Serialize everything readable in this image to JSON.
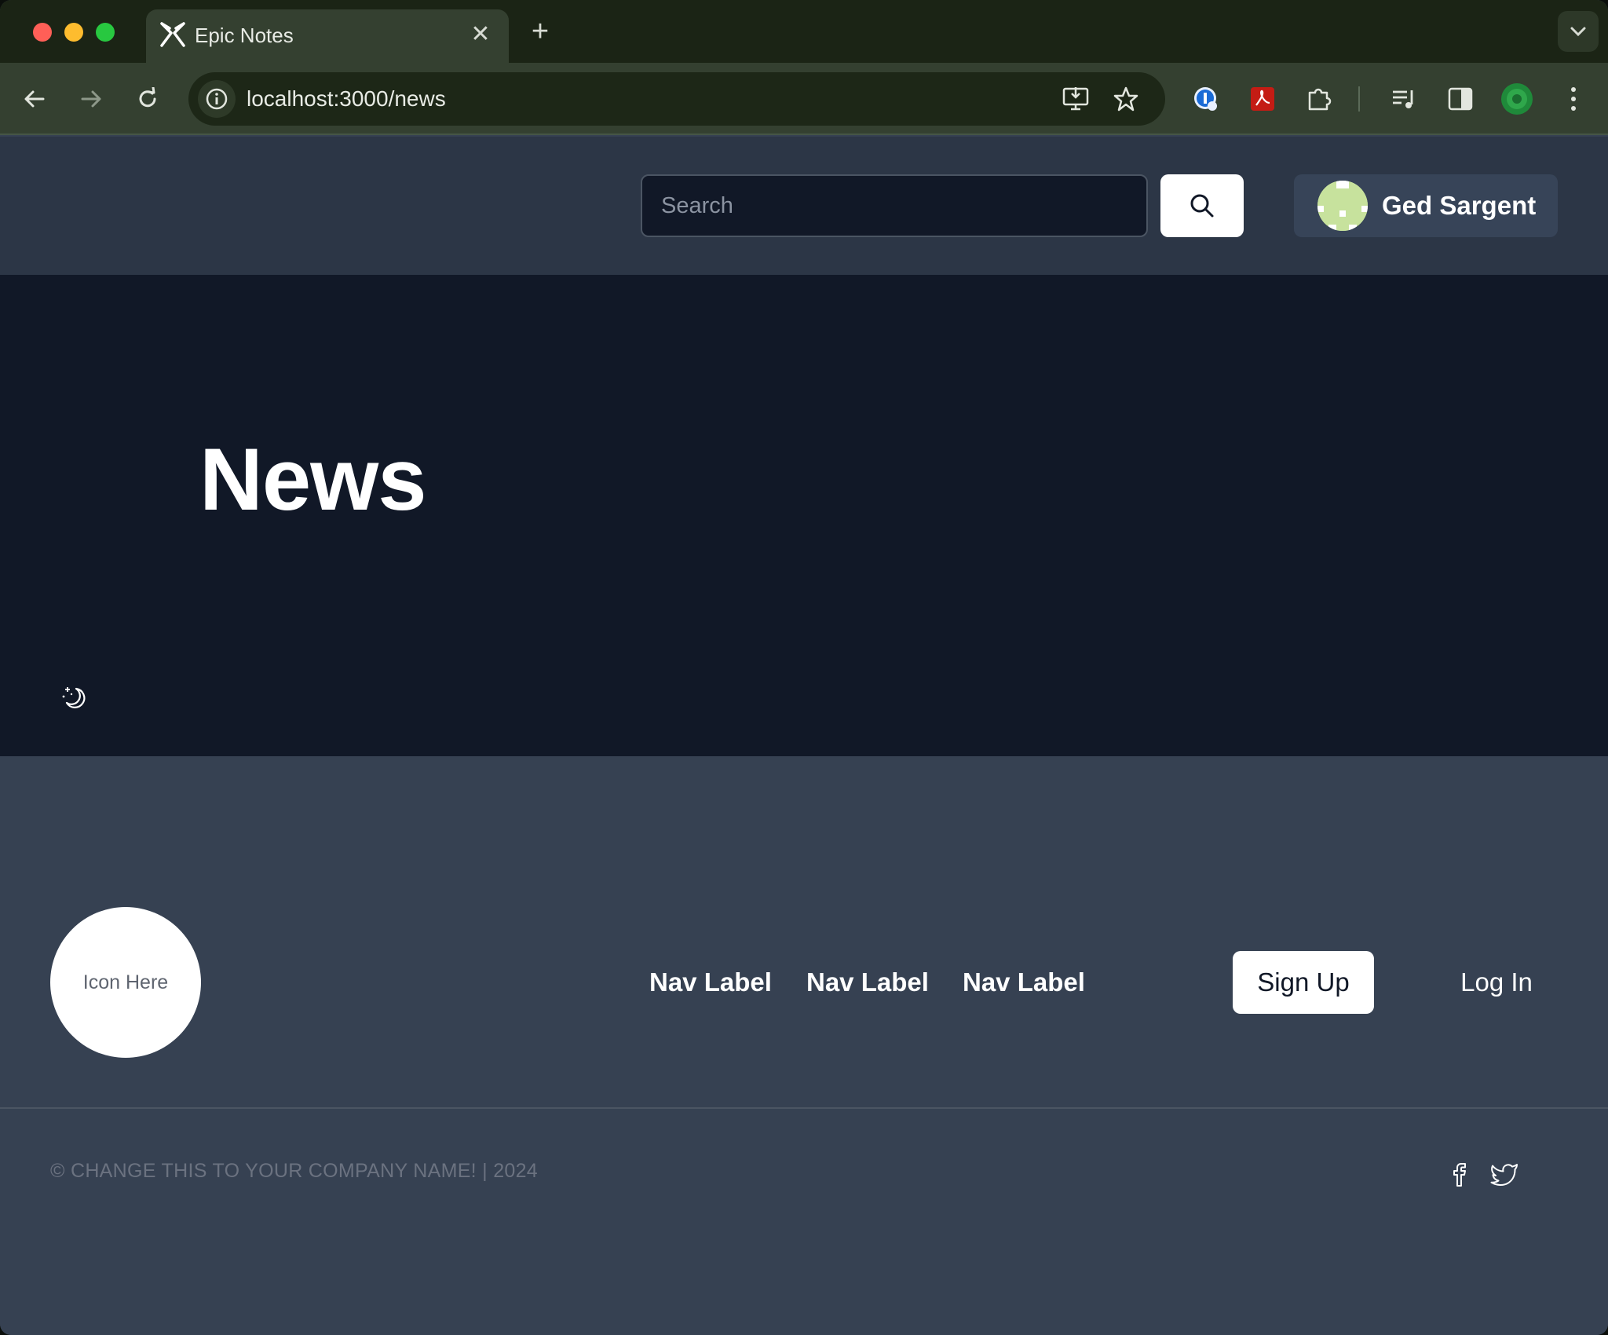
{
  "browser": {
    "tab_title": "Epic Notes",
    "close_glyph": "✕",
    "new_tab_glyph": "+",
    "url": "localhost:3000/news"
  },
  "header": {
    "search": {
      "placeholder": "Search",
      "value": ""
    },
    "user": {
      "name": "Ged Sargent"
    }
  },
  "hero": {
    "title": "News"
  },
  "footer": {
    "logo_text": "Icon Here",
    "nav": [
      {
        "label": "Nav Label"
      },
      {
        "label": "Nav Label"
      },
      {
        "label": "Nav Label"
      }
    ],
    "signup_label": "Sign Up",
    "login_label": "Log In",
    "copyright": "© CHANGE THIS TO YOUR COMPANY NAME! | 2024",
    "social": [
      "facebook-icon",
      "twitter-icon"
    ]
  },
  "colors": {
    "hero_bg": "#111827",
    "header_bg": "#2c3646",
    "footer_bg": "#364152",
    "browser_frame": "#1b2415",
    "browser_toolbar": "#344030"
  }
}
